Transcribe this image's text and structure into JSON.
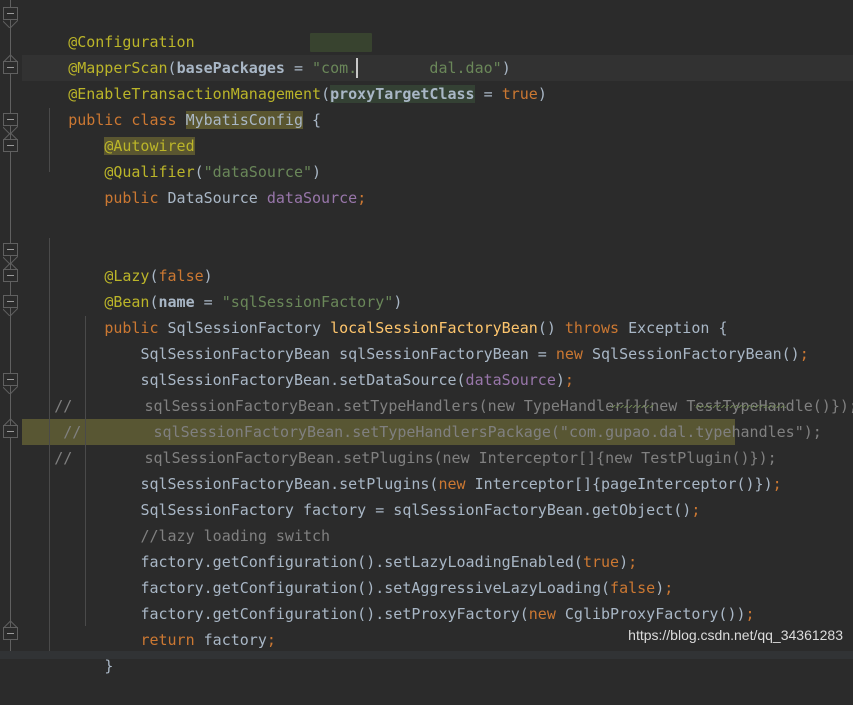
{
  "editor": {
    "theme": "darcula",
    "background": "#2b2b2b",
    "caret_line_background": "#323232",
    "highlight_background": "#585633",
    "font_size_px": 15,
    "line_height_px": 26,
    "language": "Java"
  },
  "watermark": {
    "text": "https://blog.csdn.net/qq_34361283"
  },
  "code_lines": [
    {
      "n": 1,
      "text": "@Configuration"
    },
    {
      "n": 2,
      "text": "@MapperScan(basePackages = \"com.        dal.dao\")"
    },
    {
      "n": 3,
      "text": "@EnableTransactionManagement(proxyTargetClass = true)"
    },
    {
      "n": 4,
      "text": "public class MybatisConfig {"
    },
    {
      "n": 5,
      "text": "    @Autowired"
    },
    {
      "n": 6,
      "text": "    @Qualifier(\"dataSource\")"
    },
    {
      "n": 7,
      "text": "    public DataSource dataSource;"
    },
    {
      "n": 8,
      "text": ""
    },
    {
      "n": 9,
      "text": ""
    },
    {
      "n": 10,
      "text": "    @Lazy(false)"
    },
    {
      "n": 11,
      "text": "    @Bean(name = \"sqlSessionFactory\")"
    },
    {
      "n": 12,
      "text": "    public SqlSessionFactory localSessionFactoryBean() throws Exception {"
    },
    {
      "n": 13,
      "text": "        SqlSessionFactoryBean sqlSessionFactoryBean = new SqlSessionFactoryBean();"
    },
    {
      "n": 14,
      "text": "        sqlSessionFactoryBean.setDataSource(dataSource);"
    },
    {
      "n": 15,
      "text": "//        sqlSessionFactoryBean.setTypeHandlers(new TypeHandler[]{new TestTypeHandle()});"
    },
    {
      "n": 16,
      "text": " //        sqlSessionFactoryBean.setTypeHandlersPackage(\"com.gupao.dal.typehandles\");"
    },
    {
      "n": 17,
      "text": "//        sqlSessionFactoryBean.setPlugins(new Interceptor[]{new TestPlugin()});"
    },
    {
      "n": 18,
      "text": "        sqlSessionFactoryBean.setPlugins(new Interceptor[]{pageInterceptor()});"
    },
    {
      "n": 19,
      "text": "        SqlSessionFactory factory = sqlSessionFactoryBean.getObject();"
    },
    {
      "n": 20,
      "text": "        //lazy loading switch"
    },
    {
      "n": 21,
      "text": "        factory.getConfiguration().setLazyLoadingEnabled(true);"
    },
    {
      "n": 22,
      "text": "        factory.getConfiguration().setAggressiveLazyLoading(false);"
    },
    {
      "n": 23,
      "text": "        factory.getConfiguration().setProxyFactory(new CglibProxyFactory());"
    },
    {
      "n": 24,
      "text": "        return factory;"
    },
    {
      "n": 25,
      "text": "    }"
    }
  ],
  "tokens": {
    "annotations": [
      "@Configuration",
      "@MapperScan",
      "@EnableTransactionManagement",
      "@Autowired",
      "@Qualifier",
      "@Lazy",
      "@Bean"
    ],
    "keywords": [
      "public",
      "class",
      "new",
      "throws",
      "return",
      "true",
      "false"
    ],
    "strings": [
      "\"com.        dal.dao\"",
      "\"dataSource\"",
      "\"sqlSessionFactory\"",
      "\"com.gupao.dal.typehandles\""
    ],
    "types": [
      "DataSource",
      "SqlSessionFactory",
      "SqlSessionFactoryBean",
      "Exception",
      "TypeHandler",
      "Interceptor",
      "CglibProxyFactory",
      "MybatisConfig"
    ],
    "methods": [
      "localSessionFactoryBean"
    ],
    "fields": [
      "dataSource"
    ]
  },
  "selection": {
    "text": "proxyTargetClass",
    "line": 3,
    "background": "#344134",
    "caret_visible": true
  },
  "occurrence_highlights": [
    {
      "text": "MybatisConfig",
      "line": 4,
      "background": "#5a5630"
    },
    {
      "text": "@Autowired",
      "line": 5,
      "background": "#5a5630"
    }
  ],
  "redaction": {
    "line": 2,
    "covers": "package name segment",
    "color": "#38432f"
  },
  "highlighted_line": {
    "line": 17,
    "text": "//        sqlSessionFactoryBean.setPlugins(new Interceptor[]{new TestPlugin()});",
    "background": "#585633"
  },
  "caret_line": {
    "line": 3,
    "background": "#323232"
  },
  "gutter": {
    "fold_markers": [
      {
        "line": 1,
        "type": "expanded-start"
      },
      {
        "line": 3,
        "type": "expanded-end"
      },
      {
        "line": 5,
        "type": "expanded-start"
      },
      {
        "line": 6,
        "type": "expanded-end"
      },
      {
        "line": 10,
        "type": "expanded-start"
      },
      {
        "line": 11,
        "type": "expanded-end"
      },
      {
        "line": 12,
        "type": "expanded-start"
      },
      {
        "line": 15,
        "type": "expanded-start"
      },
      {
        "line": 17,
        "type": "expanded-end"
      },
      {
        "line": 25,
        "type": "expanded-end"
      }
    ],
    "rail_color": "#606060"
  },
  "typo_squiggles": [
    {
      "line": 16,
      "word": "gupao"
    },
    {
      "line": 16,
      "word": "typehandles"
    }
  ]
}
